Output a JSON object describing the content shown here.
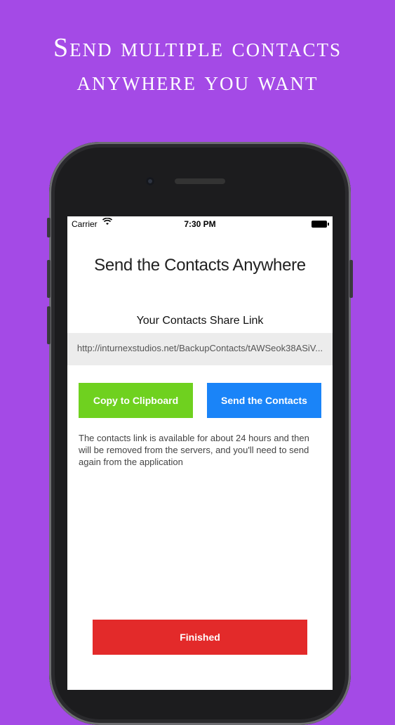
{
  "headline": {
    "line1": "Send multiple contacts",
    "line2": "anywhere you want"
  },
  "status_bar": {
    "carrier": "Carrier",
    "time": "7:30 PM",
    "wifi_icon": "wifi-icon",
    "battery_icon": "battery-icon"
  },
  "screen": {
    "title": "Send the Contacts Anywhere",
    "share_label": "Your Contacts Share Link",
    "share_link": "http://inturnexstudios.net/BackupContacts/tAWSeok38ASiV...",
    "copy_button": "Copy to Clipboard",
    "send_button": "Send the Contacts",
    "info_text": "The contacts link is available for about 24 hours and then will be removed from the servers, and you'll need to send again from the application",
    "finished_button": "Finished"
  },
  "colors": {
    "background": "#a44ae6",
    "copy_button": "#6fd11f",
    "send_button": "#1a84f8",
    "finished_button": "#e32a2a"
  }
}
